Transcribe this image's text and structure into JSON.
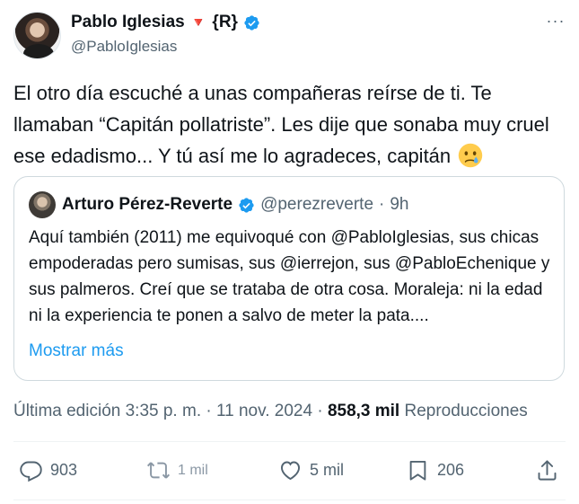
{
  "author": {
    "name": "Pablo Iglesias",
    "flag": "🔻",
    "tag": "{R}",
    "handle": "@PabloIglesias",
    "verified": true
  },
  "tweet": {
    "text": "El otro día escuché a unas compañeras reírse de ti. Te llamaban “Capitán pollatriste”. Les dije que sonaba muy cruel ese edadismo... Y tú así me lo agradeces, capitán",
    "emoji": "crying-face"
  },
  "quote": {
    "name": "Arturo Pérez-Reverte",
    "handle": "@perezreverte",
    "separator": "·",
    "time": "9h",
    "text": "Aquí también (2011) me equivoqué con @PabloIglesias, sus chicas empoderadas pero sumisas, sus @ierrejon, sus @PabloEchenique y sus palmeros. Creí que se trataba de otra cosa. Moraleja: ni la edad ni la experiencia te ponen a salvo de meter la pata....",
    "show_more": "Mostrar más"
  },
  "meta": {
    "edited": "Última edición 3:35 p. m.",
    "sep1": " · ",
    "date": "11 nov. 2024",
    "sep2": " · ",
    "views": "858,3 mil",
    "views_label": " Reproducciones"
  },
  "actions": {
    "replies": "903",
    "retweets": "1 mil",
    "likes": "5 mil",
    "bookmarks": "206"
  },
  "colors": {
    "accent": "#1d9bf0",
    "secondary_text": "#536471",
    "border": "#cfd9de"
  }
}
